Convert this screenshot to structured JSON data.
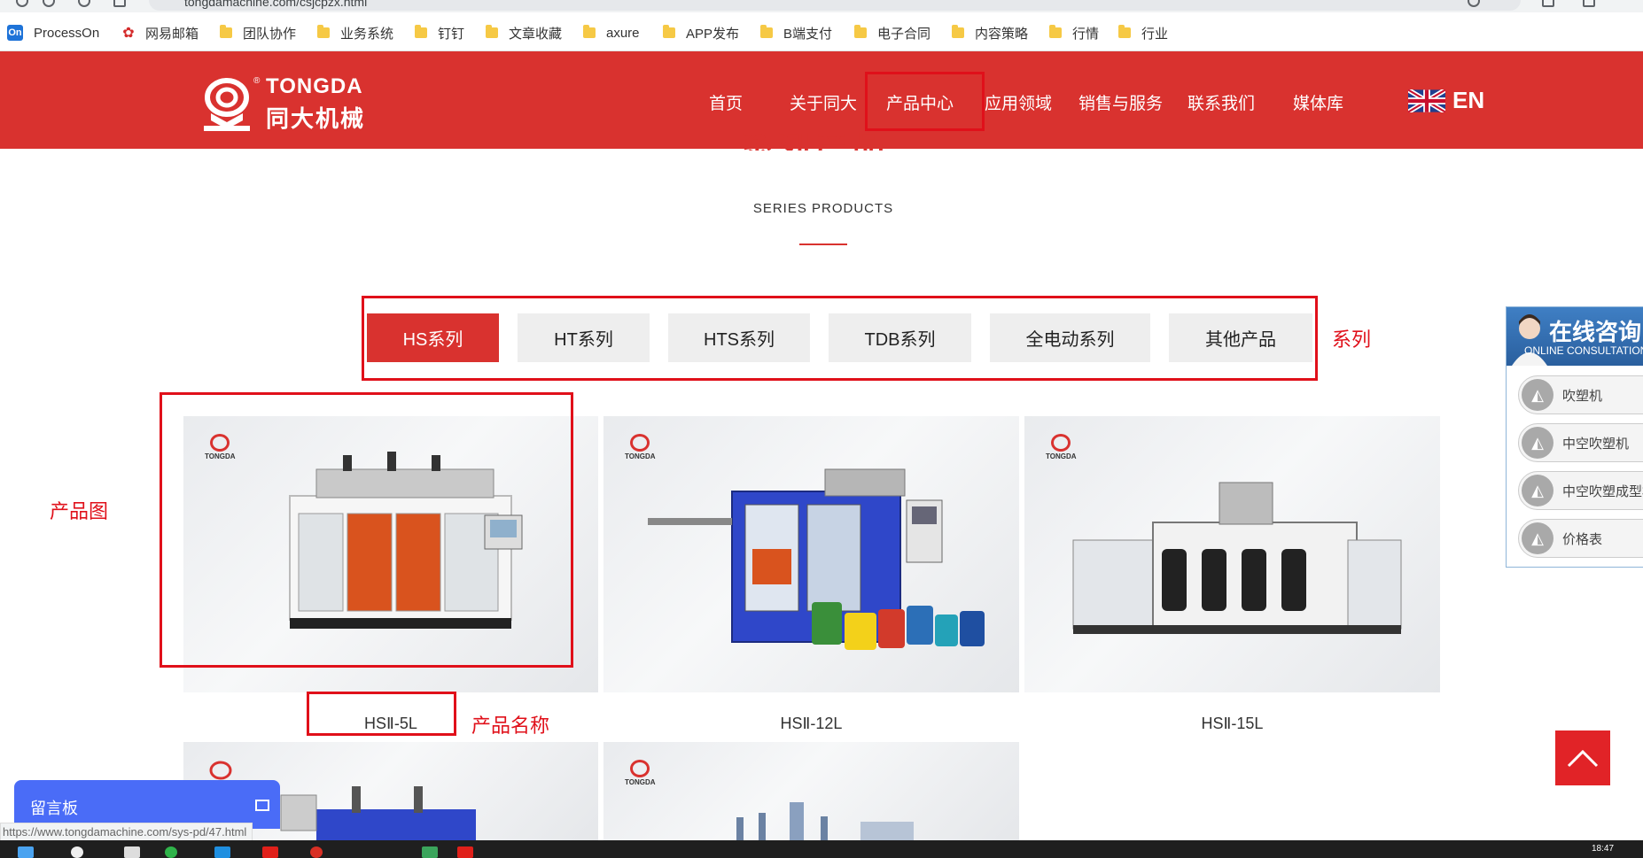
{
  "browser": {
    "url": "tongdamachine.com/csjcpzx.html",
    "bookmarks": [
      "ProcessOn",
      "网易邮箱",
      "团队协作",
      "业务系统",
      "钉钉",
      "文章收藏",
      "axure",
      "APP发布",
      "B端支付",
      "电子合同",
      "内容策略",
      "行情",
      "行业"
    ]
  },
  "header": {
    "logo_en": "TONGDA",
    "logo_cn": "同大机械",
    "nav": [
      "首页",
      "关于同大",
      "产品中心",
      "应用领域",
      "销售与服务",
      "联系我们",
      "媒体库"
    ],
    "active_nav": "产品中心",
    "lang": "EN"
  },
  "series": {
    "title_cn": "系列产品",
    "subtitle": "SERIES PRODUCTS",
    "tabs": [
      "HS系列",
      "HT系列",
      "HTS系列",
      "TDB系列",
      "全电动系列",
      "其他产品"
    ],
    "active_tab": "HS系列"
  },
  "products": [
    {
      "name": "HSⅡ-5L",
      "brand": "TONGDA"
    },
    {
      "name": "HSⅡ-12L",
      "brand": "TONGDA"
    },
    {
      "name": "HSⅡ-15L",
      "brand": "TONGDA"
    },
    {
      "name": "",
      "brand": ""
    },
    {
      "name": "",
      "brand": "TONGDA"
    }
  ],
  "annotations": {
    "series_label": "系列",
    "image_label": "产品图",
    "name_label": "产品名称"
  },
  "consult": {
    "title": "在线咨询",
    "subtitle": "ONLINE CONSULTATION",
    "items": [
      "吹塑机",
      "中空吹塑机",
      "中空吹塑成型机",
      "价格表"
    ]
  },
  "message_board": {
    "label": "留言板"
  },
  "status_bar": {
    "url": "https://www.tongdamachine.com/sys-pd/47.html"
  },
  "taskbar": {
    "time": "18:47"
  },
  "colors": {
    "brand_red": "#d9322f",
    "annotation_red": "#e0101a",
    "message_blue": "#4a6cf7"
  }
}
